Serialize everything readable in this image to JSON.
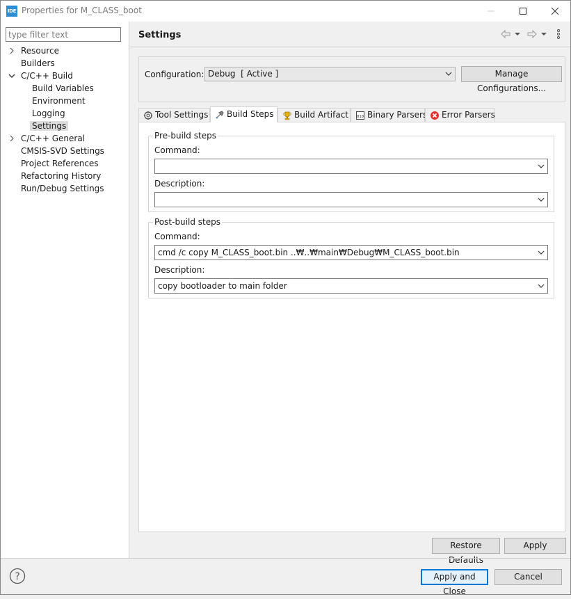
{
  "window": {
    "app_icon_label": "IDE",
    "title": "Properties for M_CLASS_boot"
  },
  "left": {
    "filter_placeholder": "type filter text",
    "tree": [
      {
        "label": "Resource",
        "level": 0,
        "chevron": "right"
      },
      {
        "label": "Builders",
        "level": 0,
        "chevron": "none"
      },
      {
        "label": "C/C++ Build",
        "level": 0,
        "chevron": "down"
      },
      {
        "label": "Build Variables",
        "level": 1,
        "chevron": "none"
      },
      {
        "label": "Environment",
        "level": 1,
        "chevron": "none"
      },
      {
        "label": "Logging",
        "level": 1,
        "chevron": "none"
      },
      {
        "label": "Settings",
        "level": 1,
        "chevron": "none",
        "selected": true
      },
      {
        "label": "C/C++ General",
        "level": 0,
        "chevron": "right"
      },
      {
        "label": "CMSIS-SVD Settings",
        "level": 0,
        "chevron": "none"
      },
      {
        "label": "Project References",
        "level": 0,
        "chevron": "none"
      },
      {
        "label": "Refactoring History",
        "level": 0,
        "chevron": "none"
      },
      {
        "label": "Run/Debug Settings",
        "level": 0,
        "chevron": "none"
      }
    ]
  },
  "right": {
    "title": "Settings",
    "configuration_label": "Configuration:",
    "configuration_value": "Debug  [ Active ]",
    "manage_button": "Manage Configurations...",
    "tabs": [
      {
        "label": "Tool Settings",
        "icon": "tool-settings-icon"
      },
      {
        "label": "Build Steps",
        "icon": "build-steps-icon",
        "active": true
      },
      {
        "label": "Build Artifact",
        "icon": "trophy-icon"
      },
      {
        "label": "Binary Parsers",
        "icon": "binary-icon"
      },
      {
        "label": "Error Parsers",
        "icon": "error-icon"
      }
    ],
    "prebuild": {
      "title": "Pre-build steps",
      "command_label": "Command:",
      "command_value": "",
      "description_label": "Description:",
      "description_value": ""
    },
    "postbuild": {
      "title": "Post-build steps",
      "command_label": "Command:",
      "command_value": "cmd /c copy M_CLASS_boot.bin ..₩..₩main₩Debug₩M_CLASS_boot.bin",
      "description_label": "Description:",
      "description_value": "copy bootloader to main folder"
    },
    "restore_defaults": "Restore Defaults",
    "apply": "Apply"
  },
  "footer": {
    "apply_and_close": "Apply and Close",
    "cancel": "Cancel"
  },
  "colors": {
    "accent": "#0078d7",
    "error": "#e03030",
    "trophy": "#e8b400"
  }
}
